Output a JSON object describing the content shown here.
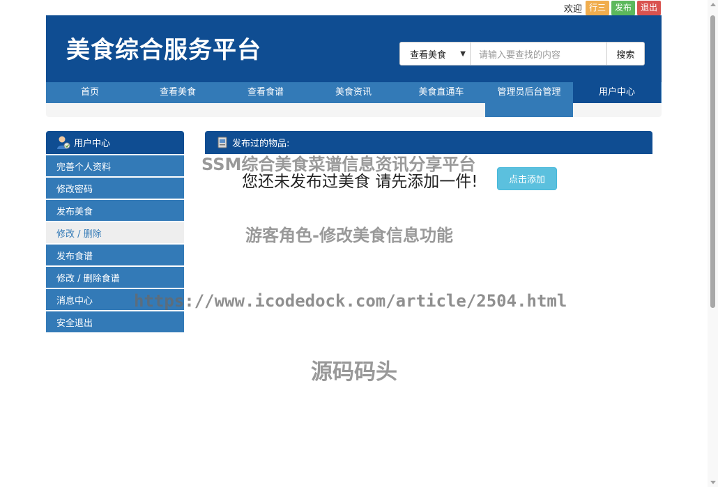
{
  "userbar": {
    "welcome": "欢迎",
    "username": "行三",
    "post_label": "发布",
    "logout_label": "退出"
  },
  "header": {
    "site_title": "美食综合服务平台",
    "search": {
      "select_value": "查看美食",
      "placeholder": "请输入要查找的内容",
      "button_label": "搜索"
    }
  },
  "nav": {
    "items": [
      {
        "label": "首页"
      },
      {
        "label": "查看美食"
      },
      {
        "label": "查看食谱"
      },
      {
        "label": "美食资讯"
      },
      {
        "label": "美食直通车"
      },
      {
        "label": "管理员后台管理"
      },
      {
        "label": "用户中心"
      }
    ]
  },
  "sidebar": {
    "title": "用户中心",
    "items": [
      {
        "label": "完善个人资料"
      },
      {
        "label": "修改密码"
      },
      {
        "label": "发布美食"
      },
      {
        "label": "修改 / 删除"
      },
      {
        "label": "发布食谱"
      },
      {
        "label": "修改 / 删除食谱"
      },
      {
        "label": "消息中心"
      },
      {
        "label": "安全退出"
      }
    ]
  },
  "main": {
    "title": "发布过的物品:",
    "empty_message": "您还未发布过美食 请先添加一件!",
    "add_button": "点击添加"
  },
  "watermarks": {
    "line1": "SSM综合美食菜谱信息资讯分享平台",
    "line2": "游客角色-修改美食信息功能",
    "line3": "https://www.icodedock.com/article/2504.html",
    "line4": "源码码头"
  },
  "colors": {
    "header_bg": "#0f4d92",
    "nav_bg": "#337ab7",
    "btn_user": "#f0ad4e",
    "btn_post": "#5cb85c",
    "btn_exit": "#d9534f",
    "btn_add": "#5bc0de"
  }
}
